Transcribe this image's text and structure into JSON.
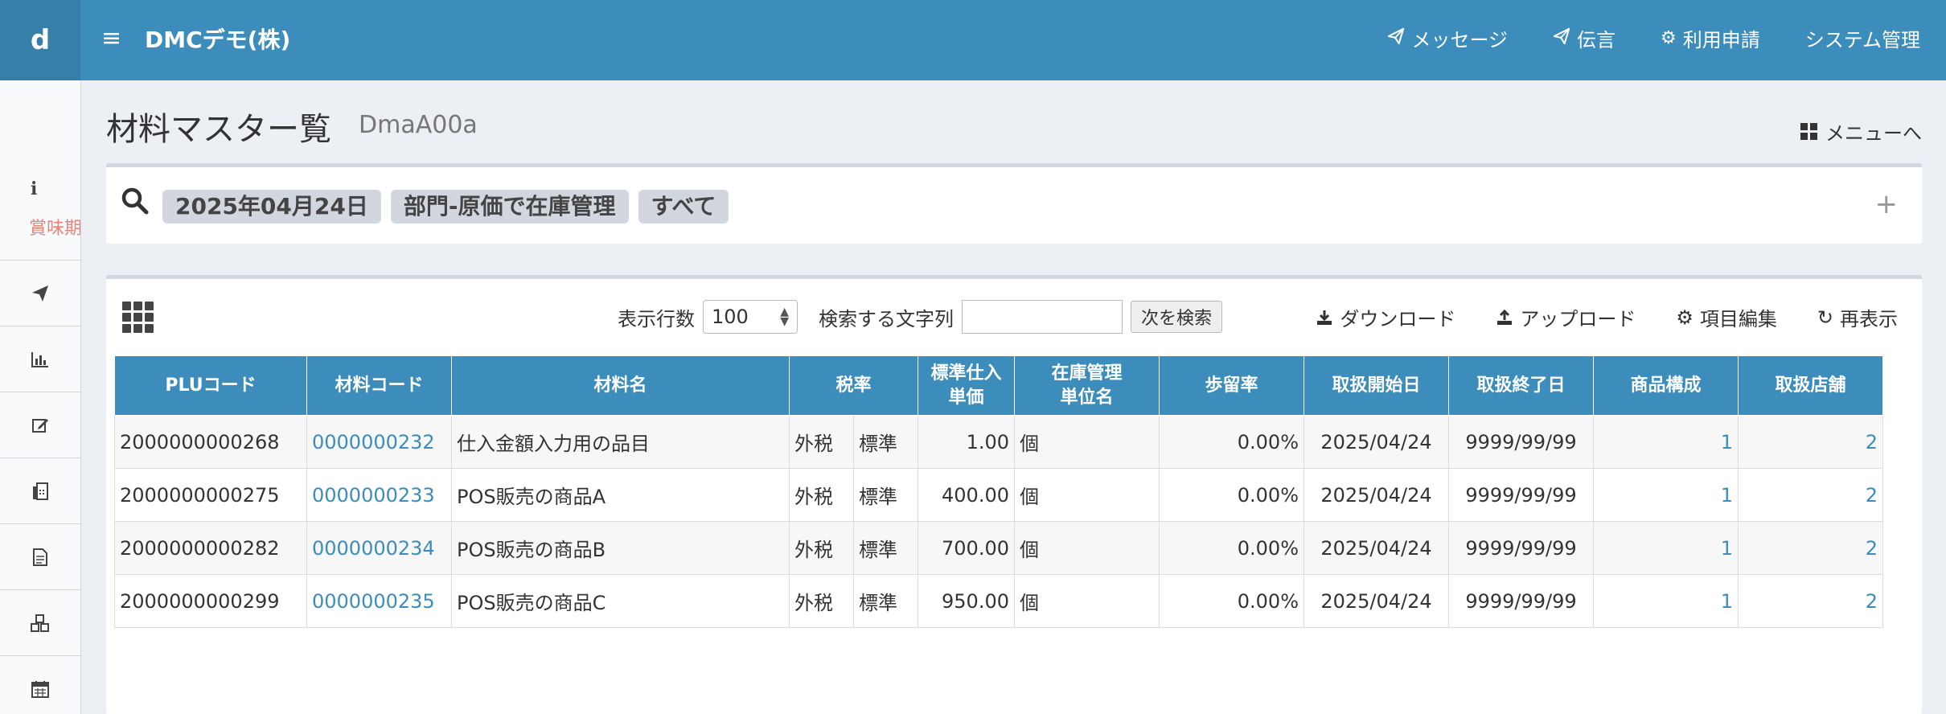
{
  "app": {
    "logo_letter": "d",
    "company": "DMCデモ(株)"
  },
  "topnav": [
    {
      "icon": "send-icon",
      "label": "メッセージ"
    },
    {
      "icon": "send-icon",
      "label": "伝言"
    },
    {
      "icon": "gear-icon",
      "label": "利用申請"
    },
    {
      "icon": "",
      "label": "システム管理"
    }
  ],
  "sidebar": {
    "first_label": "賞味期"
  },
  "page": {
    "title": "材料マスター覧",
    "code": "DmaA00a",
    "menu_link": "メニューへ"
  },
  "search": {
    "chips": [
      "2025年04月24日",
      "部門-原価で在庫管理",
      "すべて"
    ]
  },
  "toolbar": {
    "rows_label": "表示行数",
    "rows_value": "100",
    "search_label": "検索する文字列",
    "search_value": "",
    "next_button": "次を検索",
    "download": "ダウンロード",
    "upload": "アップロード",
    "edit_fields": "項目編集",
    "refresh": "再表示"
  },
  "table": {
    "headers": {
      "plu": "PLUコード",
      "material_code": "材料コード",
      "material_name": "材料名",
      "tax_rate": "税率",
      "std_price_1": "標準仕入",
      "std_price_2": "単価",
      "stock_unit_1": "在庫管理",
      "stock_unit_2": "単位名",
      "yield": "歩留率",
      "start": "取扱開始日",
      "end": "取扱終了日",
      "composition": "商品構成",
      "stores": "取扱店舗"
    },
    "rows": [
      {
        "plu": "2000000000268",
        "code": "0000000232",
        "name": "仕入金額入力用の品目",
        "tax1": "外税",
        "tax2": "標準",
        "price": "1.00",
        "unit": "個",
        "yield": "0.00%",
        "start": "2025/04/24",
        "end": "9999/99/99",
        "comp": "1",
        "stores": "2"
      },
      {
        "plu": "2000000000275",
        "code": "0000000233",
        "name": "POS販売の商品A",
        "tax1": "外税",
        "tax2": "標準",
        "price": "400.00",
        "unit": "個",
        "yield": "0.00%",
        "start": "2025/04/24",
        "end": "9999/99/99",
        "comp": "1",
        "stores": "2"
      },
      {
        "plu": "2000000000282",
        "code": "0000000234",
        "name": "POS販売の商品B",
        "tax1": "外税",
        "tax2": "標準",
        "price": "700.00",
        "unit": "個",
        "yield": "0.00%",
        "start": "2025/04/24",
        "end": "9999/99/99",
        "comp": "1",
        "stores": "2"
      },
      {
        "plu": "2000000000299",
        "code": "0000000235",
        "name": "POS販売の商品C",
        "tax1": "外税",
        "tax2": "標準",
        "price": "950.00",
        "unit": "個",
        "yield": "0.00%",
        "start": "2025/04/24",
        "end": "9999/99/99",
        "comp": "1",
        "stores": "2"
      }
    ]
  },
  "colors": {
    "header_blue": "#3c8dbc",
    "link_blue": "#3c8dbc",
    "chip_gray": "#d2d6de"
  }
}
